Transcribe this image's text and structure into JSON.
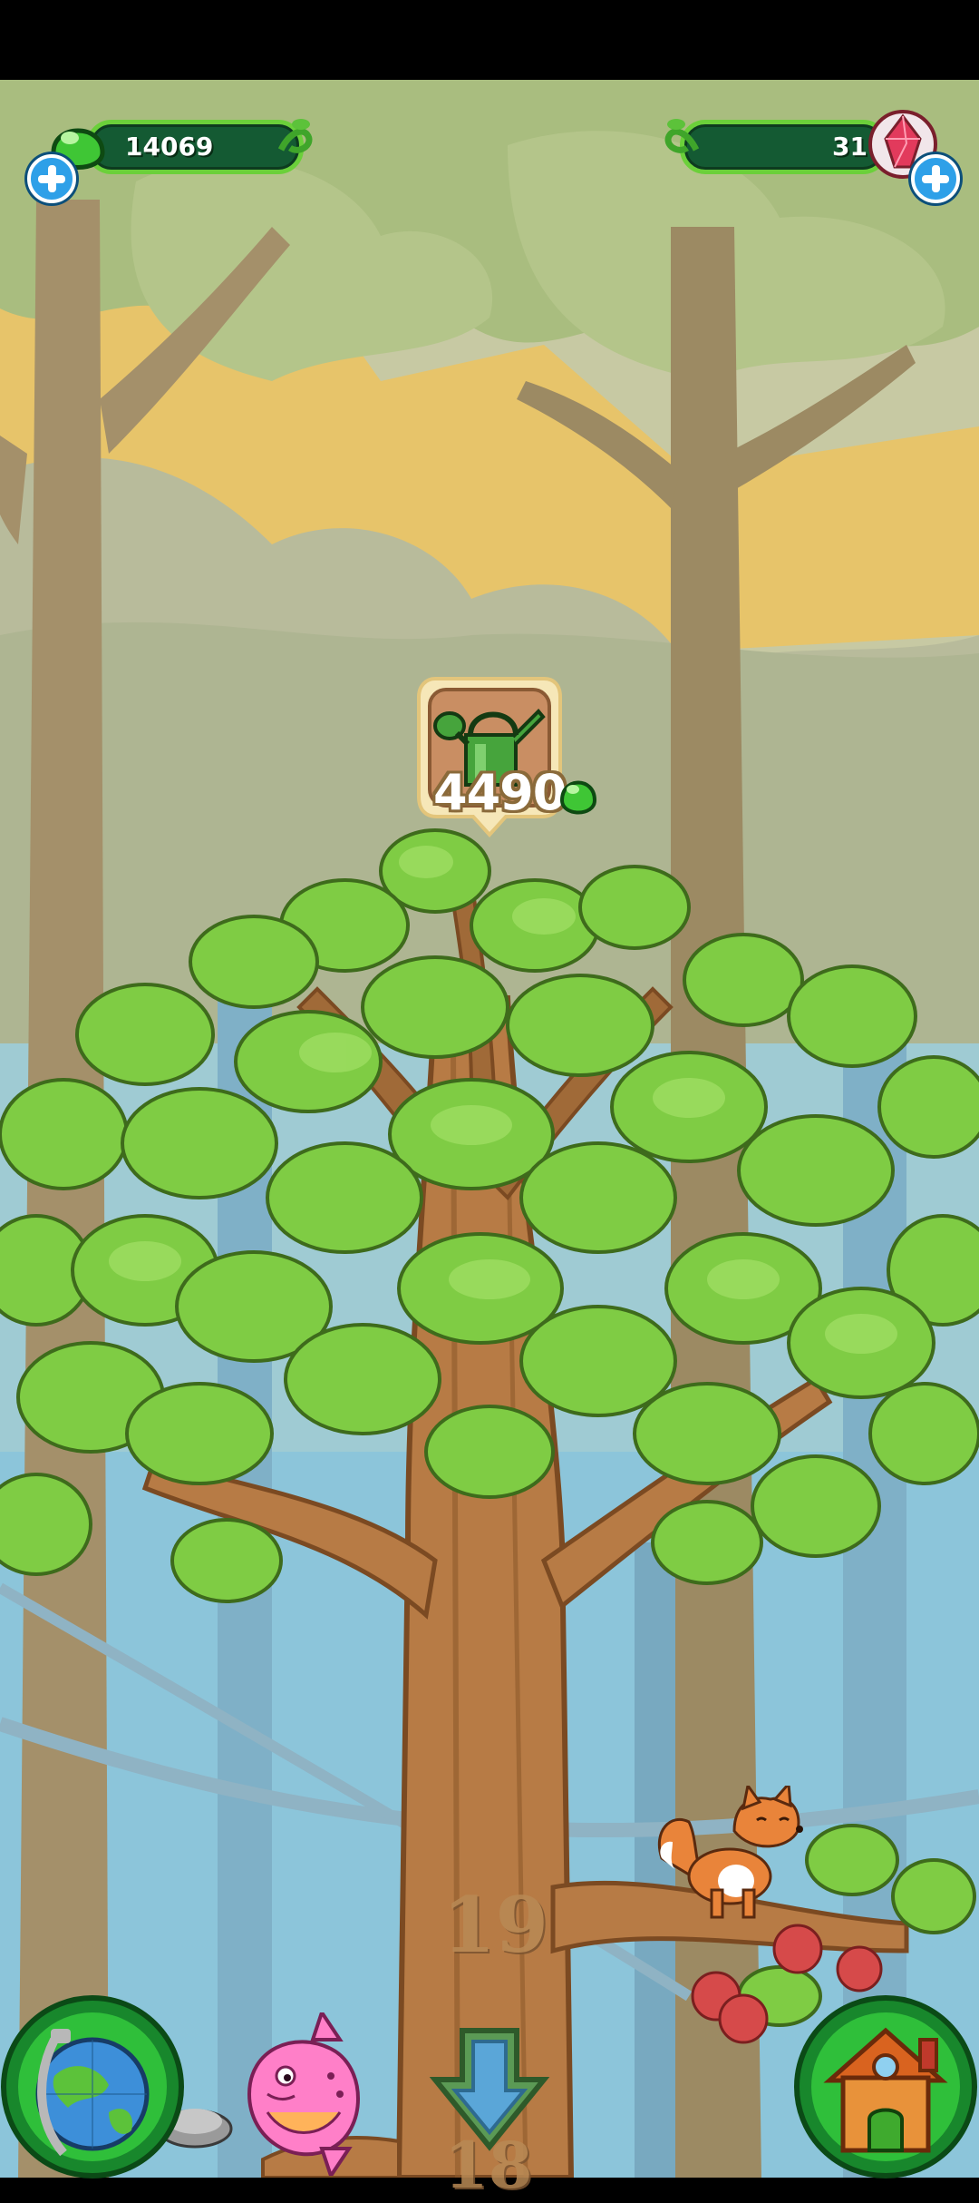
{
  "hud": {
    "gems_value": "14069",
    "crystals_value": "31"
  },
  "upgrade": {
    "cost": "4490",
    "item_icon": "watering-can-icon",
    "currency_icon": "green-gem-icon"
  },
  "tree": {
    "current_level": "19",
    "below_level": "18"
  },
  "buttons": {
    "globe": "globe-icon",
    "house": "house-icon",
    "scroll_down": "arrow-down-icon"
  },
  "colors": {
    "hud_green": "#145a33",
    "accent_green": "#6bd03a",
    "plus_blue": "#2ea0e8",
    "leaf_green": "#7fcc44",
    "trunk_brown": "#b77b45"
  }
}
